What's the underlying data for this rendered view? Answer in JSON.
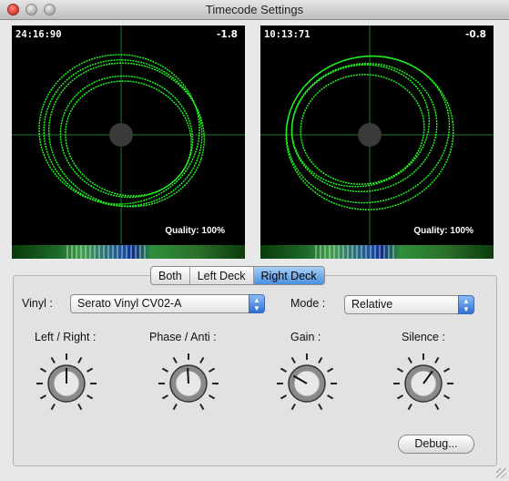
{
  "window": {
    "title": "Timecode Settings"
  },
  "scopes": {
    "left": {
      "timecode": "24:16:90",
      "offset": "-1.8",
      "quality": "Quality: 100%"
    },
    "right": {
      "timecode": "10:13:71",
      "offset": "-0.8",
      "quality": "Quality: 100%"
    }
  },
  "deck_tabs": {
    "items": [
      "Both",
      "Left Deck",
      "Right Deck"
    ],
    "selected": "Right Deck"
  },
  "vinyl": {
    "label": "Vinyl :",
    "value": "Serato Vinyl CV02-A"
  },
  "mode": {
    "label": "Mode :",
    "value": "Relative"
  },
  "knobs": [
    {
      "label": "Left / Right :",
      "level": 0.5
    },
    {
      "label": "Phase / Anti :",
      "level": 0.49
    },
    {
      "label": "Gain :",
      "level": 0.3
    },
    {
      "label": "Silence :",
      "level": 0.62
    }
  ],
  "debug_button": "Debug...",
  "colors": {
    "scope_trace": "#22ff22",
    "accent": "#4a8fe0"
  }
}
